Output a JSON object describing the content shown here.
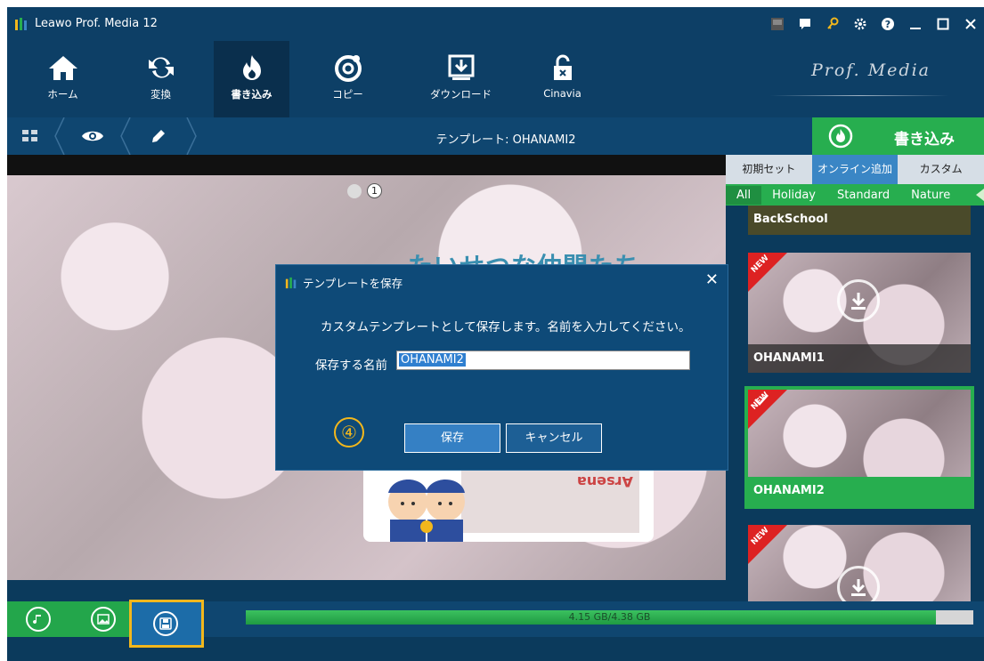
{
  "window": {
    "title": "Leawo Prof. Media 12"
  },
  "nav": {
    "items": [
      {
        "label": "ホーム"
      },
      {
        "label": "変換"
      },
      {
        "label": "書き込み"
      },
      {
        "label": "コピー"
      },
      {
        "label": "ダウンロード"
      },
      {
        "label": "Cinavia"
      }
    ],
    "brand": "Prof. Media"
  },
  "toolbar": {
    "template_title": "テンプレート: OHANAMI2",
    "burn_label": "書き込み"
  },
  "preview": {
    "page_number": "1",
    "headline": "たいせつな仲間たち",
    "stamp_text": "Arsena"
  },
  "right_panel": {
    "tabs": [
      "初期セット",
      "オンライン追加",
      "カスタム"
    ],
    "filters": [
      "All",
      "Holiday",
      "Standard",
      "Nature"
    ],
    "templates": [
      {
        "name": "BackSchool"
      },
      {
        "name": "OHANAMI1",
        "badge": "NEW"
      },
      {
        "name": "OHANAMI2",
        "badge": "NEW"
      },
      {
        "name": "",
        "badge": "NEW"
      }
    ]
  },
  "dialog": {
    "title": "テンプレートを保存",
    "message": "カスタムテンプレートとして保存します。名前を入力してください。",
    "name_label": "保存する名前",
    "name_value": "OHANAMI2",
    "step": "④",
    "save_label": "保存",
    "cancel_label": "キャンセル"
  },
  "bottom": {
    "capacity_text": "4.15 GB/4.38 GB",
    "capacity_fraction": 0.948
  },
  "colors": {
    "accent_green": "#27ae4f",
    "nav_bg": "#0d3f66",
    "highlight_yellow": "#f2b71c"
  }
}
